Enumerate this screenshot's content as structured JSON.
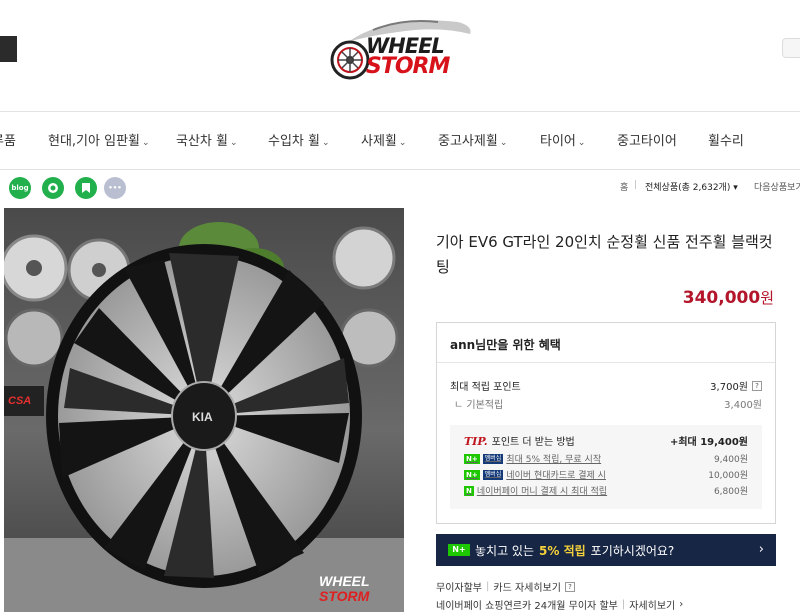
{
  "logo": {
    "line1": "WHEEL",
    "line2": "STORM"
  },
  "nav": [
    {
      "label": "전체상품보기",
      "visible_label": "루품",
      "chevron": false
    },
    {
      "label": "현대,기아 임판휠",
      "chevron": true
    },
    {
      "label": "국산차 휠",
      "chevron": true
    },
    {
      "label": "수입차 휠",
      "chevron": true
    },
    {
      "label": "사제휠",
      "chevron": true
    },
    {
      "label": "중고사제휠",
      "chevron": true
    },
    {
      "label": "타이어",
      "chevron": true
    },
    {
      "label": "중고타이어",
      "chevron": false
    },
    {
      "label": "휠수리",
      "chevron": false
    }
  ],
  "share": [
    {
      "name": "blog",
      "label": "blog",
      "color": "#21b04b"
    },
    {
      "name": "kakaostory",
      "label": "",
      "color": "#21b04b"
    },
    {
      "name": "band",
      "label": "",
      "color": "#21b04b"
    },
    {
      "name": "more",
      "label": "•••",
      "color": "#b9bfd1"
    }
  ],
  "breadcrumb": {
    "home": "홈",
    "category": "전체상품",
    "count": "(총 2,632개)",
    "next": "다음상품보기"
  },
  "product": {
    "title": "기아 EV6 GT라인 20인치 순정휠 신품 전주휠 블랙컷팅",
    "price": "340,000",
    "price_unit": "원"
  },
  "benefit": {
    "header": "ann님만을 위한 혜택",
    "max_points_label": "최대 적립 포인트",
    "max_points_value": "3,700원",
    "basic_label": "기본적립",
    "basic_value": "3,400원",
    "tip_label": "TIP.",
    "tip_title": "포인트 더 받는 방법",
    "tip_max": "+최대 19,400원",
    "tips": [
      {
        "badge": "N+",
        "badge2": "멤버십",
        "label": "최대 5% 적립, 무료 시작",
        "value": "9,400원"
      },
      {
        "badge": "N+",
        "badge2": "멤버십",
        "label": "네이버 현대카드로 결제 시",
        "value": "10,000원"
      },
      {
        "badge": "N",
        "badge2": "",
        "label": "네이버페이 머니 결제 시 최대 적립",
        "value": "6,800원"
      }
    ]
  },
  "banner": {
    "badge": "N+",
    "text_before": "놓치고 있는",
    "highlight": "5% 적립",
    "text_after": "포기하시겠어요?",
    "arrow": "›"
  },
  "footer": {
    "installment": "무이자할부",
    "card_details": "카드 자세히보기",
    "npay_installment": "네이버페이 쇼핑연르카 24개월 무이자 할부",
    "npay_details": "자세히보기"
  },
  "colors": {
    "price": "#b3162a",
    "banner_bg": "#182645",
    "banner_highlight": "#f4d13a",
    "npay_green": "#1ec800",
    "tip_red": "#c0141c"
  }
}
